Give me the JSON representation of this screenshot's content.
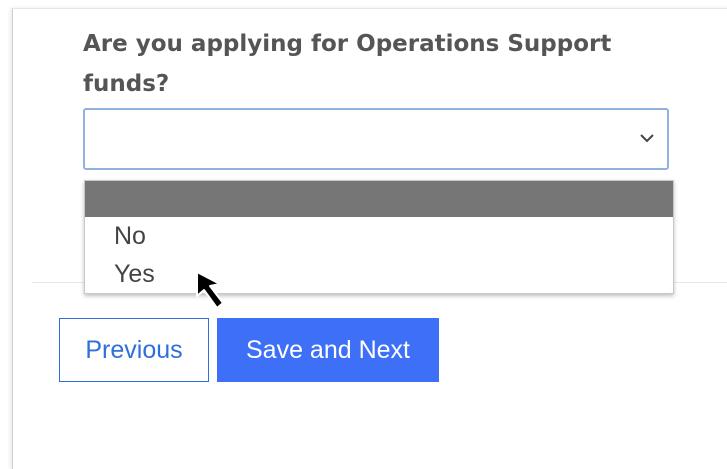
{
  "form": {
    "question": "Are you applying for Operations Support funds?",
    "select": {
      "value": "",
      "icon": "chevron-down-icon"
    },
    "dropdown_options": [
      {
        "label": "",
        "highlighted": true
      },
      {
        "label": "No",
        "highlighted": false
      },
      {
        "label": "Yes",
        "highlighted": false
      }
    ]
  },
  "buttons": {
    "previous_label": "Previous",
    "next_label": "Save and Next"
  },
  "colors": {
    "accent": "#3d6ff7",
    "secondary_border": "#2e6fd8",
    "focus_border": "#8fb3dd",
    "highlight": "#767676",
    "question_text": "#555555"
  },
  "cursor": {
    "icon": "mouse-pointer-icon"
  }
}
